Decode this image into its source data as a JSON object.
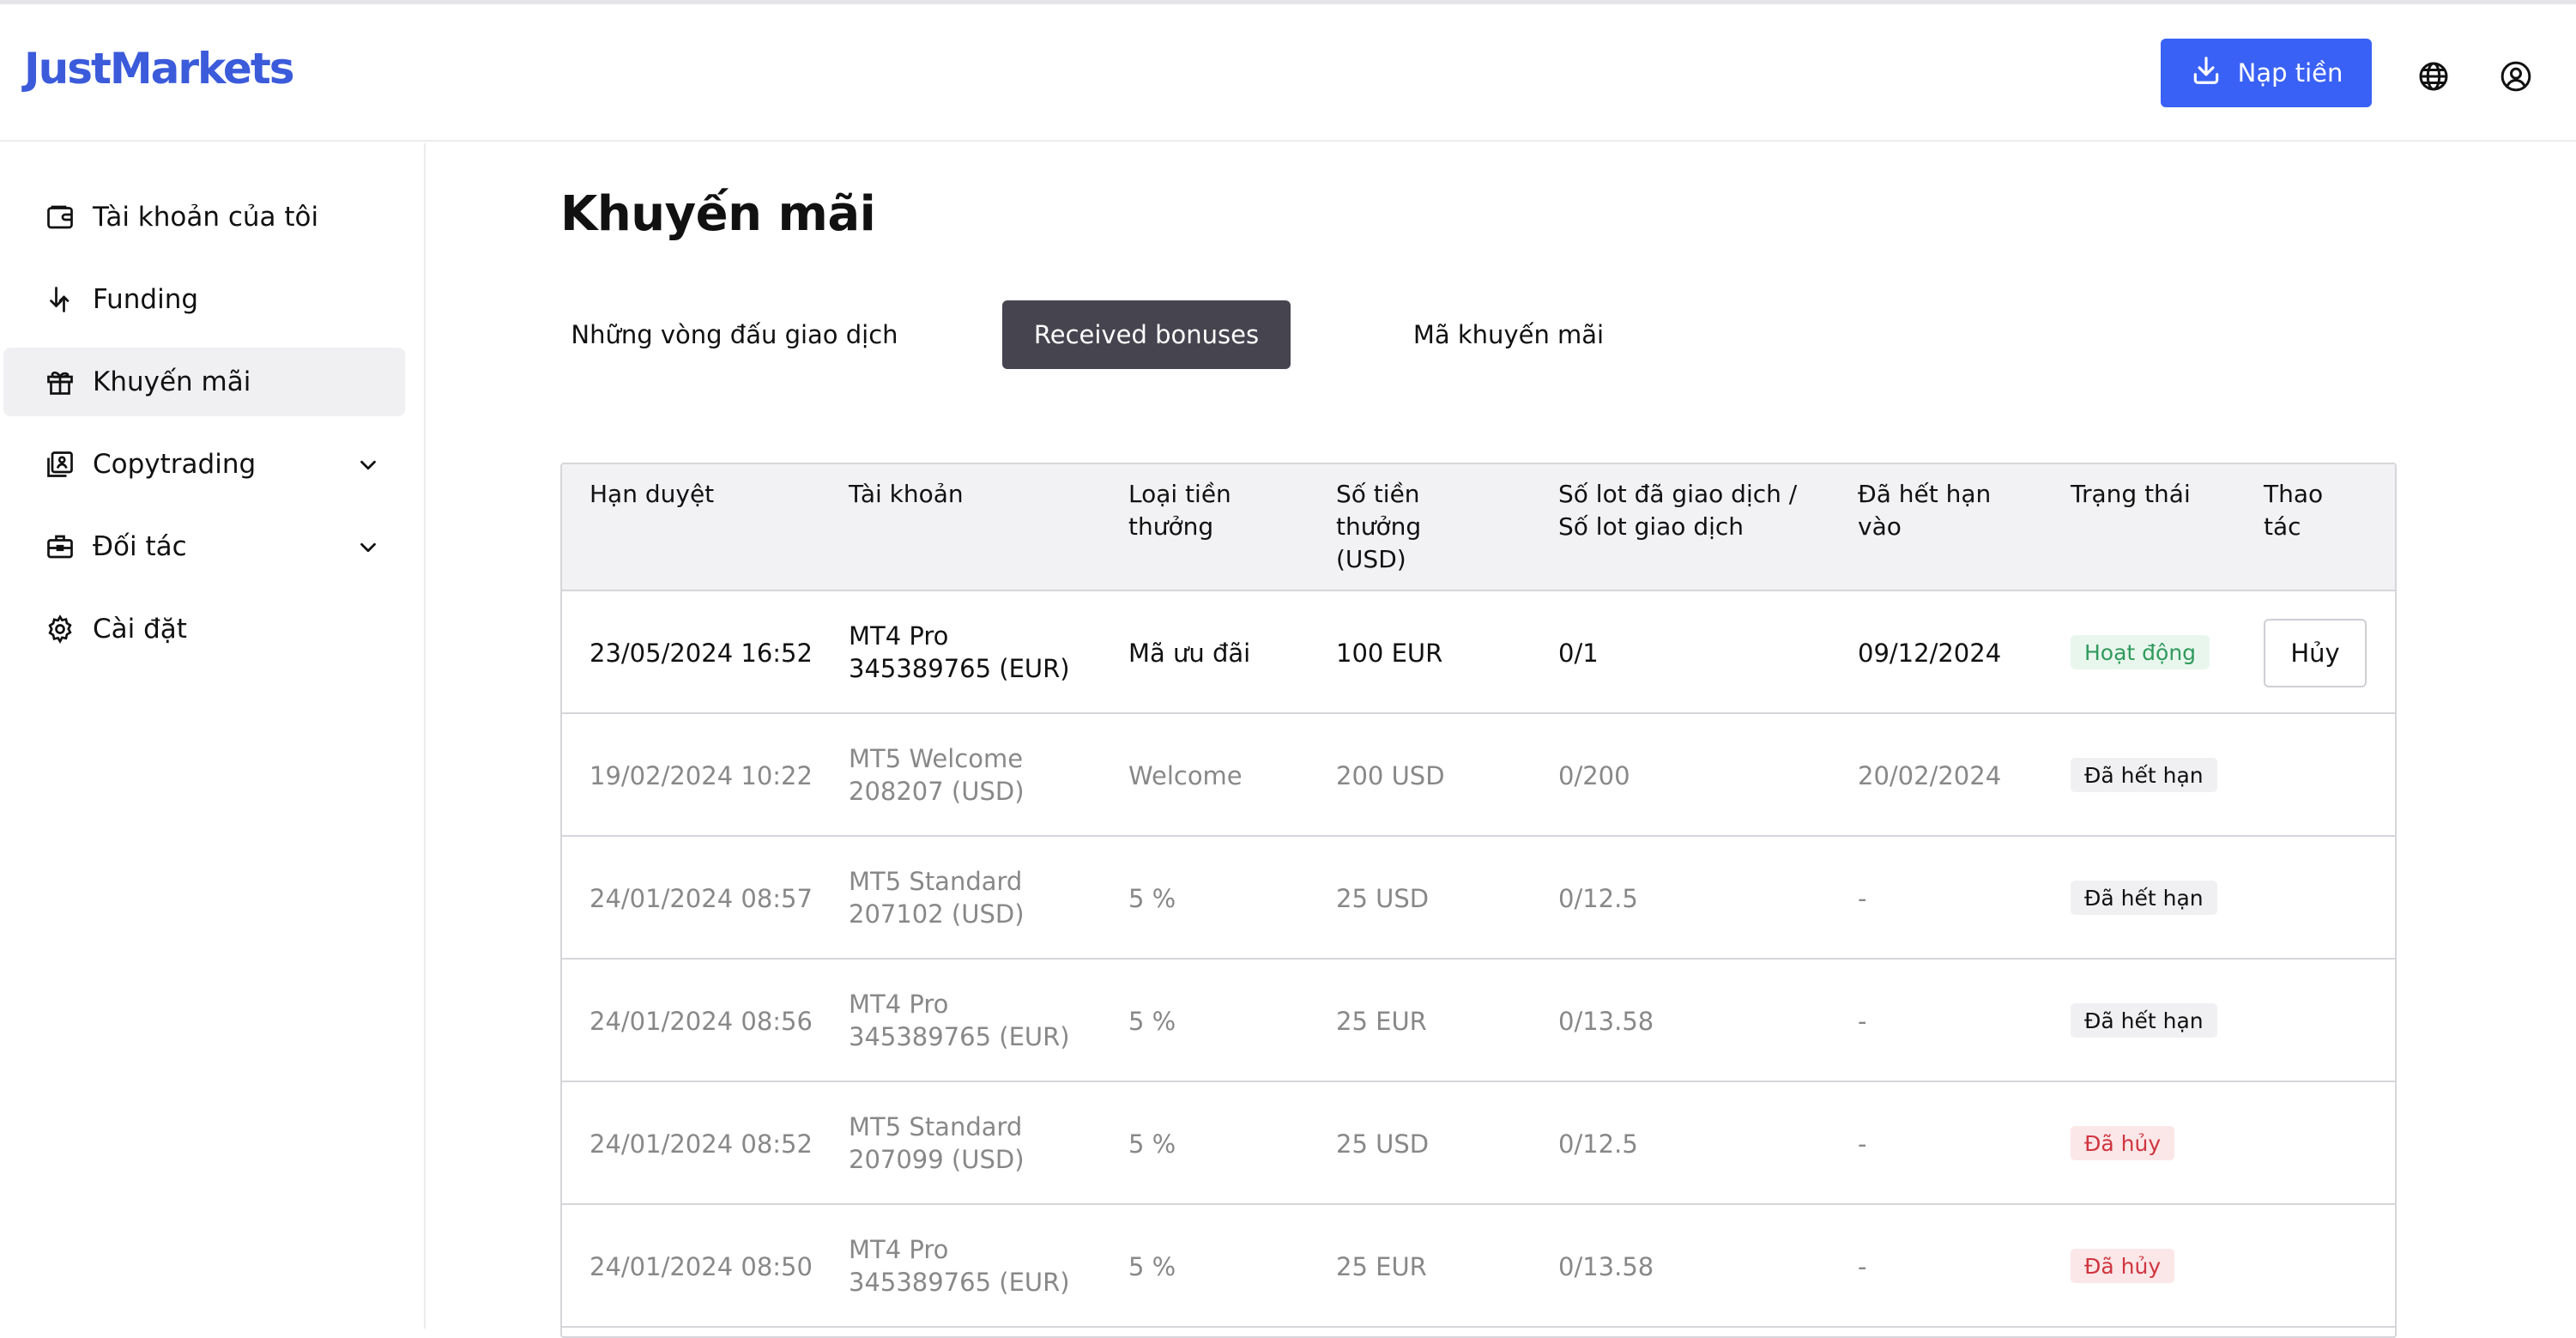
{
  "brand": {
    "logo": "JustMarkets",
    "accent": "#3961f5"
  },
  "header": {
    "deposit_label": "Nạp tiền",
    "icons": [
      "download-icon",
      "globe-icon",
      "user-icon"
    ]
  },
  "sidebar": {
    "items": [
      {
        "label": "Tài khoản của tôi",
        "icon": "wallet-icon"
      },
      {
        "label": "Funding",
        "icon": "funding-arrows-icon"
      },
      {
        "label": "Khuyến mãi",
        "icon": "gift-icon",
        "active": true
      },
      {
        "label": "Copytrading",
        "icon": "copytrading-icon",
        "expandable": true
      },
      {
        "label": "Đối tác",
        "icon": "briefcase-icon",
        "expandable": true
      },
      {
        "label": "Cài đặt",
        "icon": "gear-icon"
      }
    ]
  },
  "main": {
    "title": "Khuyến mãi",
    "tabs": [
      {
        "label": "Những vòng đấu giao dịch"
      },
      {
        "label": "Received bonuses",
        "active": true
      },
      {
        "label": "Mã khuyến mãi"
      }
    ],
    "table": {
      "headers": [
        "Hạn duyệt",
        "Tài khoản",
        "Loại tiền\nthưởng",
        "Số tiền\nthưởng\n(USD)",
        "Số lot đã giao dịch /\nSố lot giao dịch",
        "Đã hết hạn\nvào",
        "Trạng thái",
        "Thao\ntác"
      ],
      "rows": [
        {
          "date": "23/05/2024 16:52",
          "account_type": "MT4 Pro",
          "account_id": "345389765 (EUR)",
          "bonus_type": "Mã ưu đãi",
          "amount": "100 EUR",
          "lots": "0/1",
          "expires": "09/12/2024",
          "status": "Hoạt động",
          "status_kind": "active",
          "action": "Hủy"
        },
        {
          "date": "19/02/2024 10:22",
          "account_type": "MT5 Welcome",
          "account_id": "208207 (USD)",
          "bonus_type": "Welcome",
          "amount": "200 USD",
          "lots": "0/200",
          "expires": "20/02/2024",
          "status": "Đã hết hạn",
          "status_kind": "expired"
        },
        {
          "date": "24/01/2024 08:57",
          "account_type": "MT5 Standard",
          "account_id": "207102 (USD)",
          "bonus_type": "5 %",
          "amount": "25 USD",
          "lots": "0/12.5",
          "expires": "-",
          "status": "Đã hết hạn",
          "status_kind": "expired"
        },
        {
          "date": "24/01/2024 08:56",
          "account_type": "MT4 Pro",
          "account_id": "345389765 (EUR)",
          "bonus_type": "5 %",
          "amount": "25 EUR",
          "lots": "0/13.58",
          "expires": "-",
          "status": "Đã hết hạn",
          "status_kind": "expired"
        },
        {
          "date": "24/01/2024 08:52",
          "account_type": "MT5 Standard",
          "account_id": "207099 (USD)",
          "bonus_type": "5 %",
          "amount": "25 USD",
          "lots": "0/12.5",
          "expires": "-",
          "status": "Đã hủy",
          "status_kind": "cancelled"
        },
        {
          "date": "24/01/2024 08:50",
          "account_type": "MT4 Pro",
          "account_id": "345389765 (EUR)",
          "bonus_type": "5 %",
          "amount": "25 EUR",
          "lots": "0/13.58",
          "expires": "-",
          "status": "Đã hủy",
          "status_kind": "cancelled"
        }
      ]
    }
  }
}
